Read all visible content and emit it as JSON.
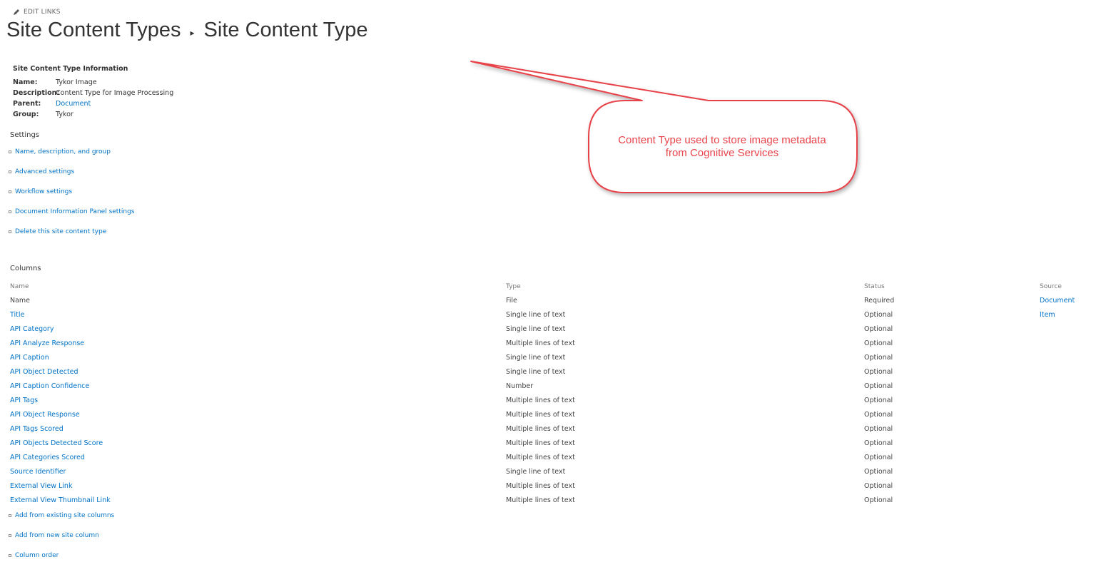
{
  "header": {
    "edit_links": "EDIT LINKS",
    "breadcrumb_parent": "Site Content Types",
    "breadcrumb_current": "Site Content Type"
  },
  "info": {
    "heading": "Site Content Type Information",
    "name_label": "Name:",
    "name_value": "Tykor Image",
    "description_label": "Description:",
    "description_value": "Content Type for Image Processing",
    "parent_label": "Parent:",
    "parent_value": "Document",
    "group_label": "Group:",
    "group_value": "Tykor"
  },
  "settings": {
    "title": "Settings",
    "items": [
      "Name, description, and group",
      "Advanced settings",
      "Workflow settings",
      "Document Information Panel settings",
      "Delete this site content type"
    ]
  },
  "columns": {
    "title": "Columns",
    "headers": {
      "name": "Name",
      "type": "Type",
      "status": "Status",
      "source": "Source"
    },
    "rows": [
      {
        "name": "Name",
        "type": "File",
        "status": "Required",
        "source": "Document"
      },
      {
        "name": "Title",
        "type": "Single line of text",
        "status": "Optional",
        "source": "Item"
      },
      {
        "name": "API Category",
        "type": "Single line of text",
        "status": "Optional",
        "source": ""
      },
      {
        "name": "API Analyze Response",
        "type": "Multiple lines of text",
        "status": "Optional",
        "source": ""
      },
      {
        "name": "API Caption",
        "type": "Single line of text",
        "status": "Optional",
        "source": ""
      },
      {
        "name": "API Object Detected",
        "type": "Single line of text",
        "status": "Optional",
        "source": ""
      },
      {
        "name": "API Caption Confidence",
        "type": "Number",
        "status": "Optional",
        "source": ""
      },
      {
        "name": "API Tags",
        "type": "Multiple lines of text",
        "status": "Optional",
        "source": ""
      },
      {
        "name": "API Object Response",
        "type": "Multiple lines of text",
        "status": "Optional",
        "source": ""
      },
      {
        "name": "API Tags Scored",
        "type": "Multiple lines of text",
        "status": "Optional",
        "source": ""
      },
      {
        "name": "API Objects Detected Score",
        "type": "Multiple lines of text",
        "status": "Optional",
        "source": ""
      },
      {
        "name": "API Categories Scored",
        "type": "Multiple lines of text",
        "status": "Optional",
        "source": ""
      },
      {
        "name": "Source Identifier",
        "type": "Single line of text",
        "status": "Optional",
        "source": ""
      },
      {
        "name": "External View Link",
        "type": "Multiple lines of text",
        "status": "Optional",
        "source": ""
      },
      {
        "name": "External View Thumbnail Link",
        "type": "Multiple lines of text",
        "status": "Optional",
        "source": ""
      }
    ],
    "actions": [
      "Add from existing site columns",
      "Add from new site column",
      "Column order"
    ]
  },
  "callout": {
    "line1": "Content Type used to store image metadata",
    "line2": "from Cognitive Services",
    "color": "#e8424a"
  },
  "colors": {
    "link": "#0072c6",
    "text": "#444444"
  }
}
